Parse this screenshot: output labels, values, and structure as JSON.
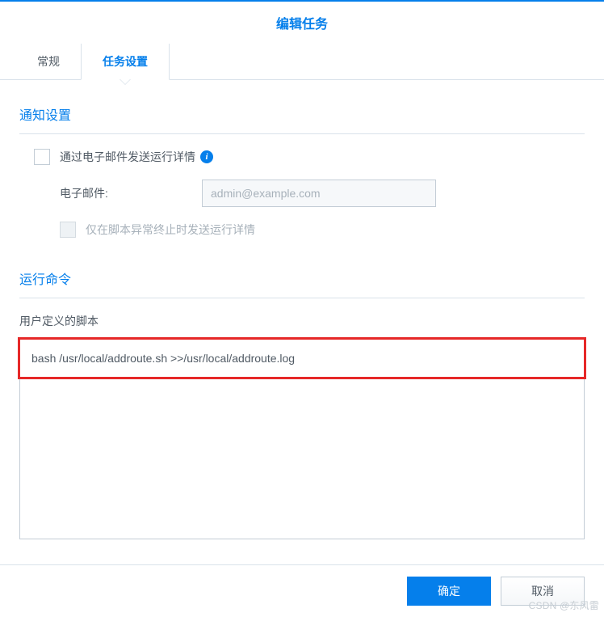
{
  "dialog": {
    "title": "编辑任务"
  },
  "tabs": {
    "general": "常规",
    "task_settings": "任务设置"
  },
  "notify": {
    "section_title": "通知设置",
    "send_email_label": "通过电子邮件发送运行详情",
    "email_label": "电子邮件:",
    "email_placeholder": "admin@example.com",
    "only_on_error_label": "仅在脚本异常终止时发送运行详情"
  },
  "runcmd": {
    "section_title": "运行命令",
    "user_script_label": "用户定义的脚本",
    "script_value": "bash /usr/local/addroute.sh >>/usr/local/addroute.log"
  },
  "buttons": {
    "ok": "确定",
    "cancel": "取消"
  },
  "watermark": "CSDN @东风雷"
}
